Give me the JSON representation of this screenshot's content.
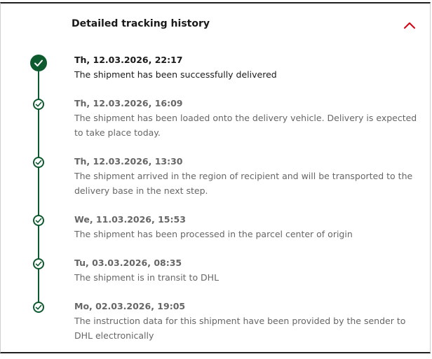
{
  "section": {
    "title": "Detailed tracking history",
    "toggle_icon": "chevron-up-icon",
    "accent_color": "#d40511",
    "timeline_color": "#0e5a2f"
  },
  "events": [
    {
      "date": "Th, 12.03.2026, 22:17",
      "description": "The shipment has been successfully delivered",
      "icon": "check-circle-filled-icon"
    },
    {
      "date": "Th, 12.03.2026, 16:09",
      "description": "The shipment has been loaded onto the delivery vehicle. Delivery is expected to take place today.",
      "icon": "check-circle-outline-icon"
    },
    {
      "date": "Th, 12.03.2026, 13:30",
      "description": "The shipment arrived in the region of recipient and will be transported to the delivery base in the next step.",
      "icon": "check-circle-outline-icon"
    },
    {
      "date": "We, 11.03.2026, 15:53",
      "description": "The shipment has been processed in the parcel center of origin",
      "icon": "check-circle-outline-icon"
    },
    {
      "date": "Tu, 03.03.2026, 08:35",
      "description": "The shipment is in transit to DHL",
      "icon": "check-circle-outline-icon"
    },
    {
      "date": "Mo, 02.03.2026, 19:05",
      "description": "The instruction data for this shipment have been provided by the sender to DHL electronically",
      "icon": "check-circle-outline-icon"
    }
  ]
}
